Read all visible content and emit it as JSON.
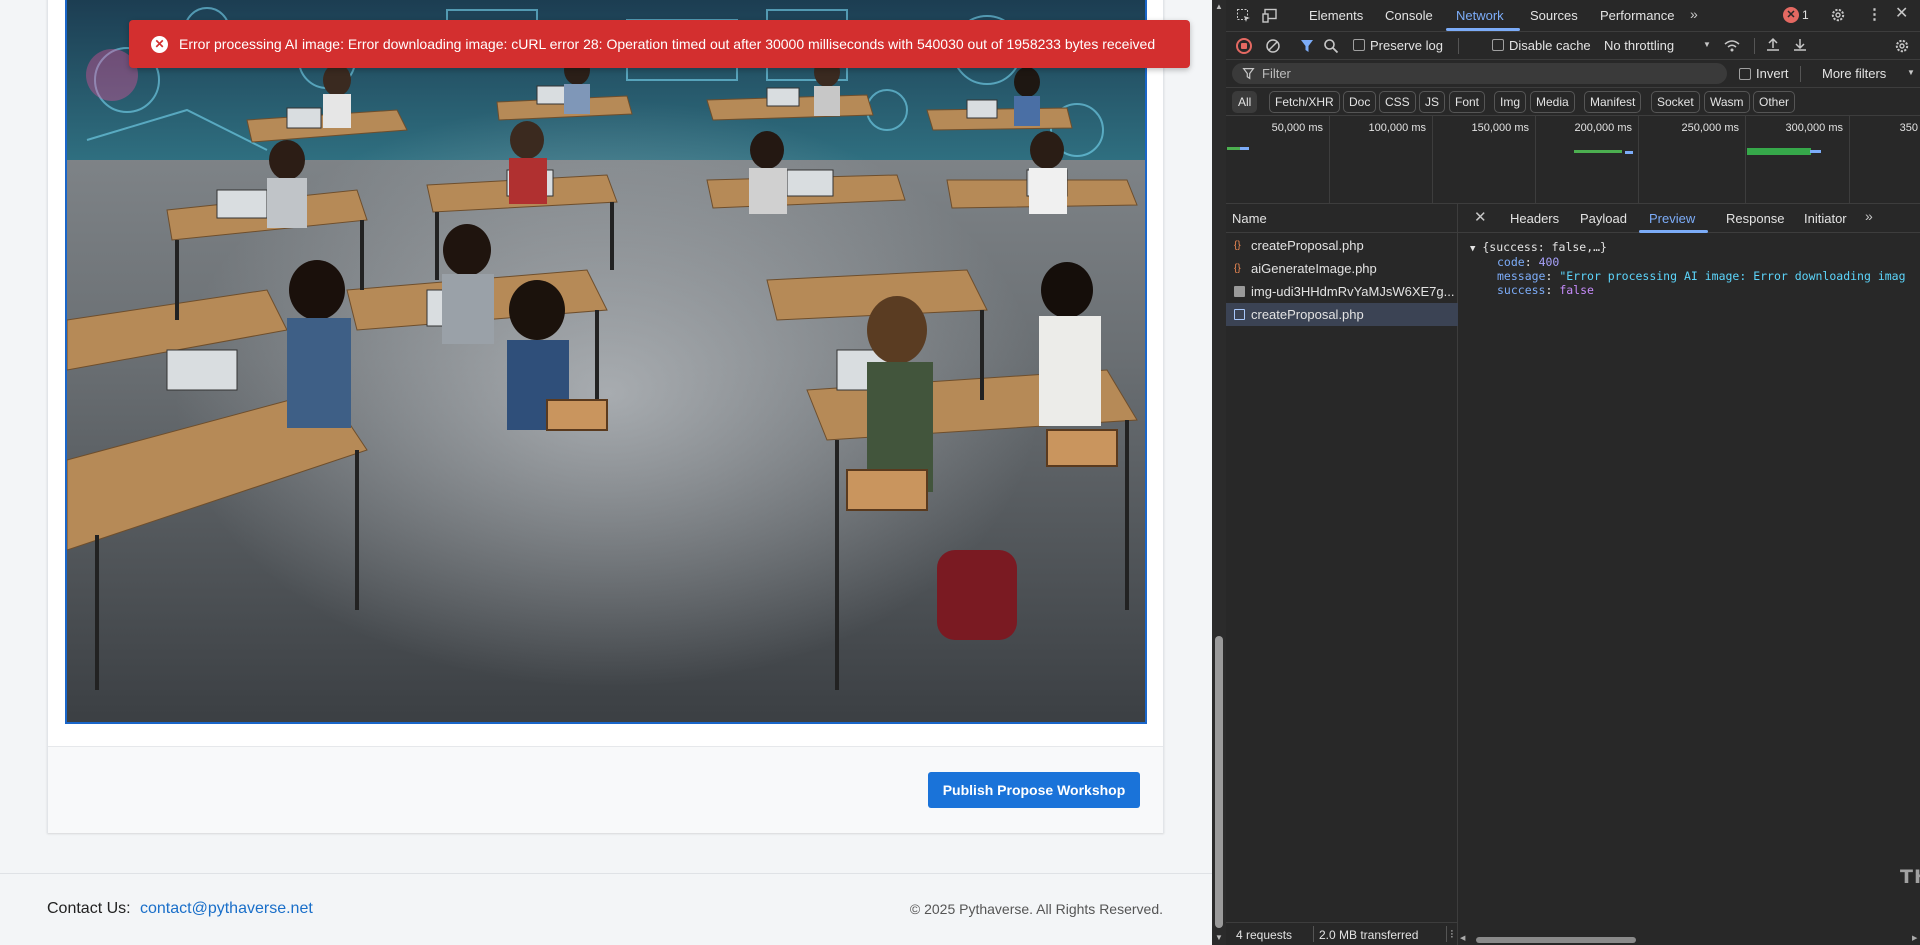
{
  "toast": {
    "icon": "error-circle-icon",
    "message": "Error processing AI image: Error downloading image: cURL error 28: Operation timed out after 30000 milliseconds with 540030 out of 1958233 bytes received"
  },
  "card": {
    "publish_label": "Publish Propose Workshop"
  },
  "footer": {
    "contact_label": "Contact Us:",
    "contact_email": "contact@pythaverse.net",
    "copyright": "© 2025 Pythaverse. All Rights Reserved."
  },
  "devtools": {
    "tabs": [
      "Elements",
      "Console",
      "Network",
      "Sources",
      "Performance"
    ],
    "active_tab": "Network",
    "error_count": "1",
    "toolbar": {
      "preserve_log": "Preserve log",
      "disable_cache": "Disable cache",
      "throttling": "No throttling"
    },
    "filter": {
      "placeholder": "Filter",
      "invert": "Invert",
      "more_filters": "More filters"
    },
    "type_filters": [
      "All",
      "Fetch/XHR",
      "Doc",
      "CSS",
      "JS",
      "Font",
      "Img",
      "Media",
      "Manifest",
      "Socket",
      "Wasm",
      "Other"
    ],
    "timeline_labels": [
      "50,000 ms",
      "100,000 ms",
      "150,000 ms",
      "200,000 ms",
      "250,000 ms",
      "300,000 ms",
      "350"
    ],
    "requests_header": "Name",
    "requests": [
      {
        "name": "createProposal.php",
        "type": "xhr"
      },
      {
        "name": "aiGenerateImage.php",
        "type": "xhr"
      },
      {
        "name": "img-udi3HHdmRvYaMJsW6XE7g...",
        "type": "img"
      },
      {
        "name": "createProposal.php",
        "type": "doc",
        "selected": true
      }
    ],
    "detail_tabs": [
      "Headers",
      "Payload",
      "Preview",
      "Response",
      "Initiator"
    ],
    "active_detail_tab": "Preview",
    "preview": {
      "summary": "{success: false,…}",
      "code_key": "code",
      "code_value": "400",
      "message_key": "message",
      "message_value": "\"Error processing AI image: Error downloading imag",
      "success_key": "success",
      "success_value": "false"
    },
    "status": {
      "requests": "4 requests",
      "transferred": "2.0 MB transferred"
    },
    "watermark": "THANHLAU.LINK"
  },
  "colors": {
    "toast_bg": "#d32f2f",
    "primary_button": "#1a73d9",
    "link": "#1a6fc9",
    "devtools_bg": "#282828",
    "devtools_accent": "#7cacf8"
  }
}
